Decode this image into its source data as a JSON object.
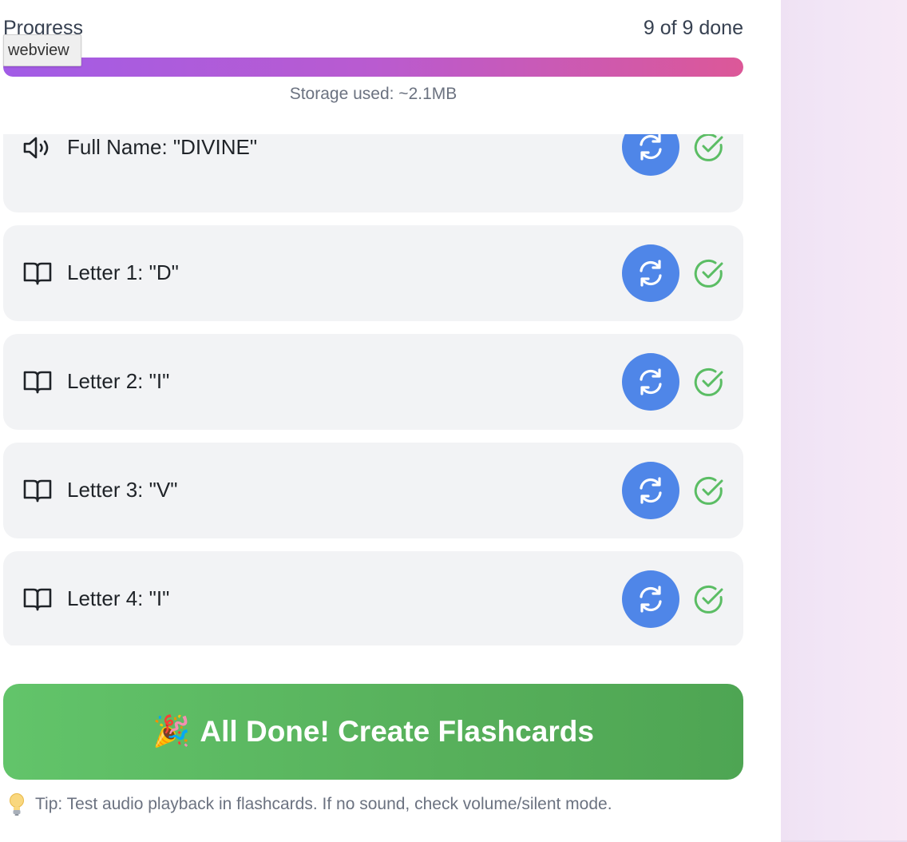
{
  "tooltip": {
    "text": "webview"
  },
  "progress": {
    "title": "Progress",
    "count_text": "9 of 9 done",
    "fraction": 1.0
  },
  "storage": {
    "text": "Storage used: ~2.1MB"
  },
  "items": [
    {
      "icon": "speaker-icon",
      "label": "Full Name: \"DIVINE\"",
      "status": "done"
    },
    {
      "icon": "book-icon",
      "label": "Letter 1: \"D\"",
      "status": "done"
    },
    {
      "icon": "book-icon",
      "label": "Letter 2: \"I\"",
      "status": "done"
    },
    {
      "icon": "book-icon",
      "label": "Letter 3: \"V\"",
      "status": "done"
    },
    {
      "icon": "book-icon",
      "label": "Letter 4: \"I\"",
      "status": "done"
    }
  ],
  "done_button": {
    "emoji": "🎉",
    "label": "All Done! Create Flashcards"
  },
  "tip": {
    "text": "Tip: Test audio playback in flashcards. If no sound, check volume/silent mode."
  },
  "colors": {
    "accent_blue": "#4f86e8",
    "success_green": "#5bbd64",
    "progress_start": "#a25ce6",
    "progress_end": "#dc5898"
  }
}
